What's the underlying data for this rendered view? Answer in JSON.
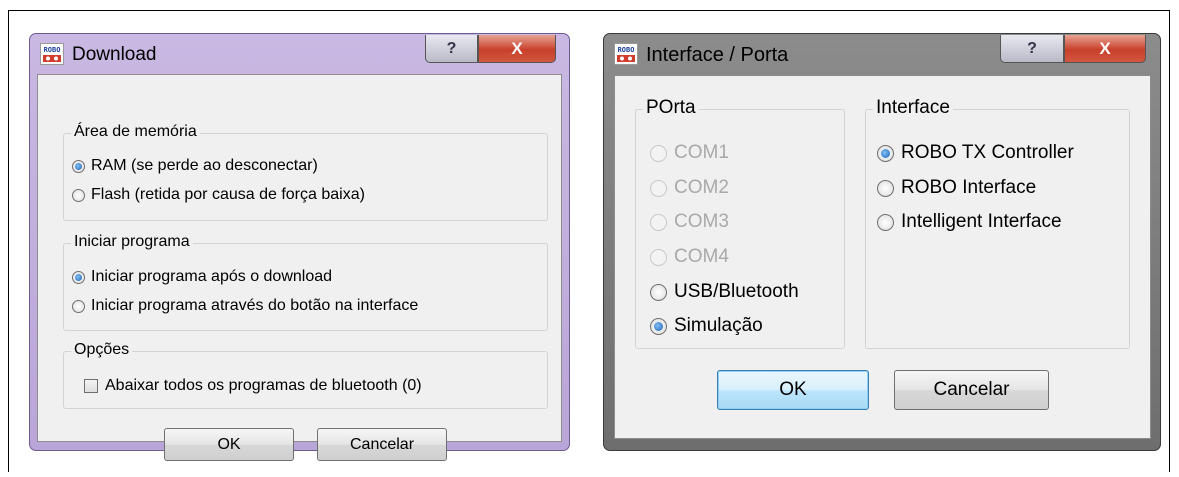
{
  "download_dialog": {
    "title": "Download",
    "icon_text": "ROBO",
    "help_label": "?",
    "close_label": "X",
    "memory_group": {
      "label": "Área de memória",
      "options": [
        {
          "label": "RAM (se perde ao desconectar)",
          "selected": true
        },
        {
          "label": "Flash (retida por causa de força baixa)",
          "selected": false
        }
      ]
    },
    "start_group": {
      "label": "Iniciar programa",
      "options": [
        {
          "label": "Iniciar programa após o download",
          "selected": true
        },
        {
          "label": "Iniciar programa através do botão na interface",
          "selected": false
        }
      ]
    },
    "options_group": {
      "label": "Opções",
      "checkbox": {
        "label": "Abaixar todos os programas de bluetooth (0)",
        "checked": false
      }
    },
    "ok_label": "OK",
    "cancel_label": "Cancelar"
  },
  "interface_dialog": {
    "title": "Interface / Porta",
    "icon_text": "ROBO",
    "help_label": "?",
    "close_label": "X",
    "port_group": {
      "label": "POrta",
      "options": [
        {
          "label": "COM1",
          "selected": false,
          "enabled": false
        },
        {
          "label": "COM2",
          "selected": false,
          "enabled": false
        },
        {
          "label": "COM3",
          "selected": false,
          "enabled": false
        },
        {
          "label": "COM4",
          "selected": false,
          "enabled": false
        },
        {
          "label": "USB/Bluetooth",
          "selected": false,
          "enabled": true
        },
        {
          "label": "Simulação",
          "selected": true,
          "enabled": true
        }
      ]
    },
    "interface_group": {
      "label": "Interface",
      "options": [
        {
          "label": "ROBO TX Controller",
          "selected": true
        },
        {
          "label": "ROBO Interface",
          "selected": false
        },
        {
          "label": "Intelligent Interface",
          "selected": false
        }
      ]
    },
    "ok_label": "OK",
    "cancel_label": "Cancelar"
  },
  "colors": {
    "download_frame": "#c9b8e2",
    "interface_frame": "#7d7d7d",
    "close_button": "#c8402c",
    "radio_selected": "#1f62b8",
    "client_background": "#f0f0f0"
  }
}
